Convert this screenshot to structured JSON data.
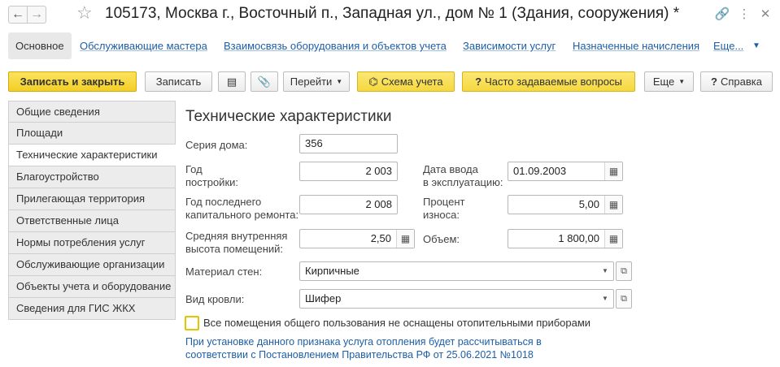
{
  "window": {
    "title": "105173, Москва г., Восточный п., Западная ул., дом № 1 (Здания, сооружения) *",
    "back_icon": "←",
    "forward_icon": "→",
    "star_icon": "☆",
    "link_icon": "🔗",
    "menu_icon": "⋮",
    "close_icon": "✕"
  },
  "nav": {
    "main": "Основное",
    "links": [
      "Обслуживающие мастера",
      "Взаимосвязь оборудования и объектов учета",
      "Зависимости услуг",
      "Назначенные начисления",
      "Еще..."
    ],
    "more_arrow": "▼"
  },
  "toolbar": {
    "save_close": "Записать и закрыть",
    "save": "Записать",
    "list_icon": "▤",
    "attach_icon": "📎",
    "goto": "Перейти",
    "scheme_icon": "⌬",
    "scheme": "Схема учета",
    "faq_icon": "?",
    "faq": "Часто задаваемые вопросы",
    "more": "Еще",
    "help_icon": "?",
    "help": "Справка",
    "caret": "▼"
  },
  "tabs": [
    "Общие сведения",
    "Площади",
    "Технические характеристики",
    "Благоустройство",
    "Прилегающая территория",
    "Ответственные лица",
    "Нормы потребления услуг",
    "Обслуживающие организации",
    "Объекты учета и оборудование",
    "Сведения для ГИС ЖКХ"
  ],
  "form": {
    "title": "Технические характеристики",
    "series_label": "Серия дома:",
    "series_value": "356",
    "year_built_label_1": "Год",
    "year_built_label_2": "постройки:",
    "year_built_value": "2 003",
    "commission_label_1": "Дата ввода",
    "commission_label_2": "в эксплуатацию:",
    "commission_value": "01.09.2003",
    "calendar_icon": "▦",
    "repair_label_1": "Год последнего",
    "repair_label_2": "капитального ремонта:",
    "repair_value": "2 008",
    "wear_label_1": "Процент",
    "wear_label_2": "износа:",
    "wear_value": "5,00",
    "calc_icon": "▦",
    "height_label_1": "Средняя внутренняя",
    "height_label_2": "высота помещений:",
    "height_value": "2,50",
    "volume_label": "Объем:",
    "volume_value": "1 800,00",
    "walls_label": "Материал стен:",
    "walls_value": "Кирпичные",
    "roof_label": "Вид кровли:",
    "roof_value": "Шифер",
    "dropdown_icon": "▼",
    "open_icon": "⧉",
    "heating_checkbox_label": "Все помещения общего пользования не оснащены отопительными приборами",
    "hint_1": "При установке данного признака услуга отопления будет рассчитываться в",
    "hint_2": "соответствии с Постановлением Правительства РФ от 25.06.2021 №1018"
  },
  "colors": {
    "accent_yellow": "#f5d530",
    "link_blue": "#1d5ea6"
  }
}
